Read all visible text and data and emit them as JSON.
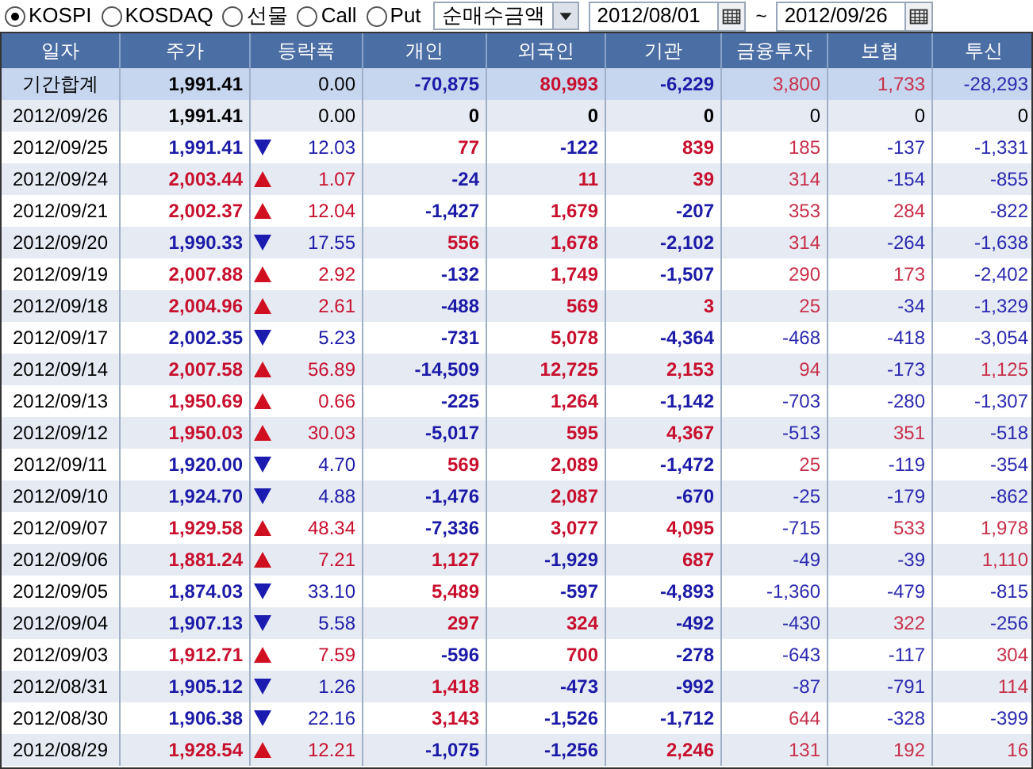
{
  "market_options": [
    {
      "label": "KOSPI",
      "selected": true
    },
    {
      "label": "KOSDAQ",
      "selected": false
    },
    {
      "label": "선물",
      "selected": false
    },
    {
      "label": "Call",
      "selected": false
    },
    {
      "label": "Put",
      "selected": false
    }
  ],
  "metric_select": {
    "value": "순매수금액"
  },
  "date_from": {
    "value": "2012/08/01"
  },
  "range_separator": "~",
  "date_to": {
    "value": "2012/09/26"
  },
  "table": {
    "columns": [
      "일자",
      "주가",
      "등락폭",
      "개인",
      "외국인",
      "기관",
      "금융투자",
      "보험",
      "투신"
    ],
    "summary": {
      "cells": [
        "기간합계",
        "1,991.41",
        "0.00",
        "-70,875",
        "80,993",
        "-6,229",
        "3,800",
        "1,733",
        "-28,293"
      ]
    },
    "rows": [
      {
        "up": false,
        "down": false,
        "cells": [
          "2012/09/26",
          "1,991.41",
          "0.00",
          "0",
          "0",
          "0",
          "0",
          "0",
          "0"
        ]
      },
      {
        "up": false,
        "down": true,
        "cells": [
          "2012/09/25",
          "1,991.41",
          "12.03",
          "77",
          "-122",
          "839",
          "185",
          "-137",
          "-1,331"
        ]
      },
      {
        "up": true,
        "down": false,
        "cells": [
          "2012/09/24",
          "2,003.44",
          "1.07",
          "-24",
          "11",
          "39",
          "314",
          "-154",
          "-855"
        ]
      },
      {
        "up": true,
        "down": false,
        "cells": [
          "2012/09/21",
          "2,002.37",
          "12.04",
          "-1,427",
          "1,679",
          "-207",
          "353",
          "284",
          "-822"
        ]
      },
      {
        "up": false,
        "down": true,
        "cells": [
          "2012/09/20",
          "1,990.33",
          "17.55",
          "556",
          "1,678",
          "-2,102",
          "314",
          "-264",
          "-1,638"
        ]
      },
      {
        "up": true,
        "down": false,
        "cells": [
          "2012/09/19",
          "2,007.88",
          "2.92",
          "-132",
          "1,749",
          "-1,507",
          "290",
          "173",
          "-2,402"
        ]
      },
      {
        "up": true,
        "down": false,
        "cells": [
          "2012/09/18",
          "2,004.96",
          "2.61",
          "-488",
          "569",
          "3",
          "25",
          "-34",
          "-1,329"
        ]
      },
      {
        "up": false,
        "down": true,
        "cells": [
          "2012/09/17",
          "2,002.35",
          "5.23",
          "-731",
          "5,078",
          "-4,364",
          "-468",
          "-418",
          "-3,054"
        ]
      },
      {
        "up": true,
        "down": false,
        "cells": [
          "2012/09/14",
          "2,007.58",
          "56.89",
          "-14,509",
          "12,725",
          "2,153",
          "94",
          "-173",
          "1,125"
        ]
      },
      {
        "up": true,
        "down": false,
        "cells": [
          "2012/09/13",
          "1,950.69",
          "0.66",
          "-225",
          "1,264",
          "-1,142",
          "-703",
          "-280",
          "-1,307"
        ]
      },
      {
        "up": true,
        "down": false,
        "cells": [
          "2012/09/12",
          "1,950.03",
          "30.03",
          "-5,017",
          "595",
          "4,367",
          "-513",
          "351",
          "-518"
        ]
      },
      {
        "up": false,
        "down": true,
        "cells": [
          "2012/09/11",
          "1,920.00",
          "4.70",
          "569",
          "2,089",
          "-1,472",
          "25",
          "-119",
          "-354"
        ]
      },
      {
        "up": false,
        "down": true,
        "cells": [
          "2012/09/10",
          "1,924.70",
          "4.88",
          "-1,476",
          "2,087",
          "-670",
          "-25",
          "-179",
          "-862"
        ]
      },
      {
        "up": true,
        "down": false,
        "cells": [
          "2012/09/07",
          "1,929.58",
          "48.34",
          "-7,336",
          "3,077",
          "4,095",
          "-715",
          "533",
          "1,978"
        ]
      },
      {
        "up": true,
        "down": false,
        "cells": [
          "2012/09/06",
          "1,881.24",
          "7.21",
          "1,127",
          "-1,929",
          "687",
          "-49",
          "-39",
          "1,110"
        ]
      },
      {
        "up": false,
        "down": true,
        "cells": [
          "2012/09/05",
          "1,874.03",
          "33.10",
          "5,489",
          "-597",
          "-4,893",
          "-1,360",
          "-479",
          "-815"
        ]
      },
      {
        "up": false,
        "down": true,
        "cells": [
          "2012/09/04",
          "1,907.13",
          "5.58",
          "297",
          "324",
          "-492",
          "-430",
          "322",
          "-256"
        ]
      },
      {
        "up": true,
        "down": false,
        "cells": [
          "2012/09/03",
          "1,912.71",
          "7.59",
          "-596",
          "700",
          "-278",
          "-643",
          "-117",
          "304"
        ]
      },
      {
        "up": false,
        "down": true,
        "cells": [
          "2012/08/31",
          "1,905.12",
          "1.26",
          "1,418",
          "-473",
          "-992",
          "-87",
          "-791",
          "114"
        ]
      },
      {
        "up": false,
        "down": true,
        "cells": [
          "2012/08/30",
          "1,906.38",
          "22.16",
          "3,143",
          "-1,526",
          "-1,712",
          "644",
          "-328",
          "-399"
        ]
      },
      {
        "up": true,
        "down": false,
        "cells": [
          "2012/08/29",
          "1,928.54",
          "12.21",
          "-1,075",
          "-1,256",
          "2,246",
          "131",
          "192",
          "16"
        ]
      }
    ]
  }
}
